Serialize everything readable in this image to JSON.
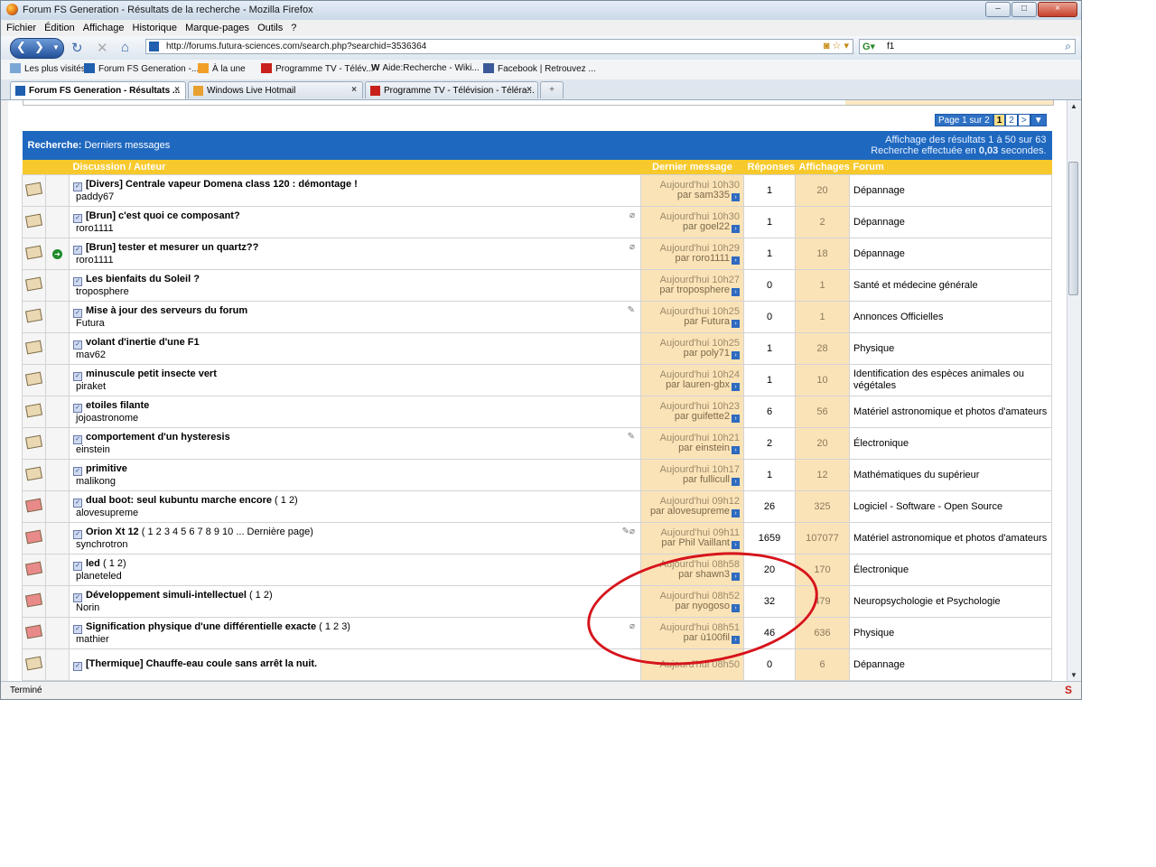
{
  "window": {
    "title": "Forum FS Generation - Résultats de la recherche - Mozilla Firefox"
  },
  "menu": [
    "Fichier",
    "Édition",
    "Affichage",
    "Historique",
    "Marque-pages",
    "Outils",
    "?"
  ],
  "nav": {
    "url": "http://forums.futura-sciences.com/search.php?searchid=3536364",
    "search_value": "f1"
  },
  "bookmarks": [
    "Les plus visités",
    "Forum FS Generation -...",
    "À la une",
    "Programme TV - Télév...",
    "Aide:Recherche - Wiki...",
    "Facebook | Retrouvez ..."
  ],
  "tabs": [
    "Forum FS Generation - Résultats ...",
    "Windows Live Hotmail",
    "Programme TV - Télévision - Téléra..."
  ],
  "status": "Terminé",
  "pager": {
    "label": "Page 1 sur 2",
    "current": "1",
    "next_page": "2",
    "next": ">"
  },
  "search_header": {
    "prefix": "Recherche:",
    "title": "Derniers messages",
    "results": "Affichage des résultats 1 à 50 sur 63",
    "timing_prefix": "Recherche effectuée en",
    "timing_value": "0,03",
    "timing_suffix": "secondes."
  },
  "columns": {
    "discussion": "Discussion / Auteur",
    "last": "Dernier message",
    "replies": "Réponses",
    "views": "Affichages",
    "forum": "Forum"
  },
  "rows": [
    {
      "title": "[Divers] Centrale vapeur Domena class 120 : démontage !",
      "pages": "",
      "author": "paddy67",
      "time": "Aujourd'hui 10h30",
      "by": "par sam335",
      "replies": "1",
      "views": "20",
      "forum": "Dépannage"
    },
    {
      "title": "[Brun] c'est quoi ce composant?",
      "pages": "",
      "author": "roro1111",
      "time": "Aujourd'hui 10h30",
      "by": "par goel22",
      "replies": "1",
      "views": "2",
      "forum": "Dépannage"
    },
    {
      "title": "[Brun] tester et mesurer un quartz??",
      "pages": "",
      "author": "roro1111",
      "time": "Aujourd'hui 10h29",
      "by": "par roro1111",
      "replies": "1",
      "views": "18",
      "forum": "Dépannage"
    },
    {
      "title": "Les bienfaits du Soleil ?",
      "pages": "",
      "author": "troposphere",
      "time": "Aujourd'hui 10h27",
      "by": "par troposphere",
      "replies": "0",
      "views": "1",
      "forum": "Santé et médecine générale"
    },
    {
      "title": "Mise à jour des serveurs du forum",
      "pages": "",
      "author": "Futura",
      "time": "Aujourd'hui 10h25",
      "by": "par Futura",
      "replies": "0",
      "views": "1",
      "forum": "Annonces Officielles"
    },
    {
      "title": "volant d'inertie d'une F1",
      "pages": "",
      "author": "mav62",
      "time": "Aujourd'hui 10h25",
      "by": "par poly71",
      "replies": "1",
      "views": "28",
      "forum": "Physique"
    },
    {
      "title": "minuscule petit insecte vert",
      "pages": "",
      "author": "piraket",
      "time": "Aujourd'hui 10h24",
      "by": "par lauren-gbx",
      "replies": "1",
      "views": "10",
      "forum": "Identification des espèces animales ou végétales"
    },
    {
      "title": "etoiles filante",
      "pages": "",
      "author": "jojoastronome",
      "time": "Aujourd'hui 10h23",
      "by": "par guifette2",
      "replies": "6",
      "views": "56",
      "forum": "Matériel astronomique et photos d'amateurs"
    },
    {
      "title": "comportement d'un hysteresis",
      "pages": "",
      "author": "einstein",
      "time": "Aujourd'hui 10h21",
      "by": "par einstein",
      "replies": "2",
      "views": "20",
      "forum": "Électronique"
    },
    {
      "title": "primitive",
      "pages": "",
      "author": "malikong",
      "time": "Aujourd'hui 10h17",
      "by": "par fullicull",
      "replies": "1",
      "views": "12",
      "forum": "Mathématiques du supérieur"
    },
    {
      "title": "dual boot: seul kubuntu marche encore",
      "pages": "( 1 2)",
      "author": "alovesupreme",
      "time": "Aujourd'hui 09h12",
      "by": "par alovesupreme",
      "replies": "26",
      "views": "325",
      "forum": "Logiciel - Software - Open Source"
    },
    {
      "title": "Orion Xt 12",
      "pages": "( 1 2 3 4 5 6 7 8 9 10 ... Dernière page)",
      "author": "synchrotron",
      "time": "Aujourd'hui 09h11",
      "by": "par Phil Vaillant",
      "replies": "1659",
      "views": "107077",
      "forum": "Matériel astronomique et photos d'amateurs"
    },
    {
      "title": "led",
      "pages": "( 1 2)",
      "author": "planeteled",
      "time": "Aujourd'hui 08h58",
      "by": "par shawn3",
      "replies": "20",
      "views": "170",
      "forum": "Électronique"
    },
    {
      "title": "Développement simuli-intellectuel",
      "pages": "( 1 2)",
      "author": "Norin",
      "time": "Aujourd'hui 08h52",
      "by": "par nyogoso",
      "replies": "32",
      "views": "479",
      "forum": "Neuropsychologie et Psychologie"
    },
    {
      "title": "Signification physique d'une différentielle exacte",
      "pages": "( 1 2 3)",
      "author": "mathier",
      "time": "Aujourd'hui 08h51",
      "by": "par ù100fil",
      "replies": "46",
      "views": "636",
      "forum": "Physique"
    },
    {
      "title": "[Thermique] Chauffe-eau coule sans arrêt la nuit.",
      "pages": "",
      "author": "",
      "time": "Aujourd'hui 08h50",
      "by": "",
      "replies": "0",
      "views": "6",
      "forum": "Dépannage"
    }
  ]
}
